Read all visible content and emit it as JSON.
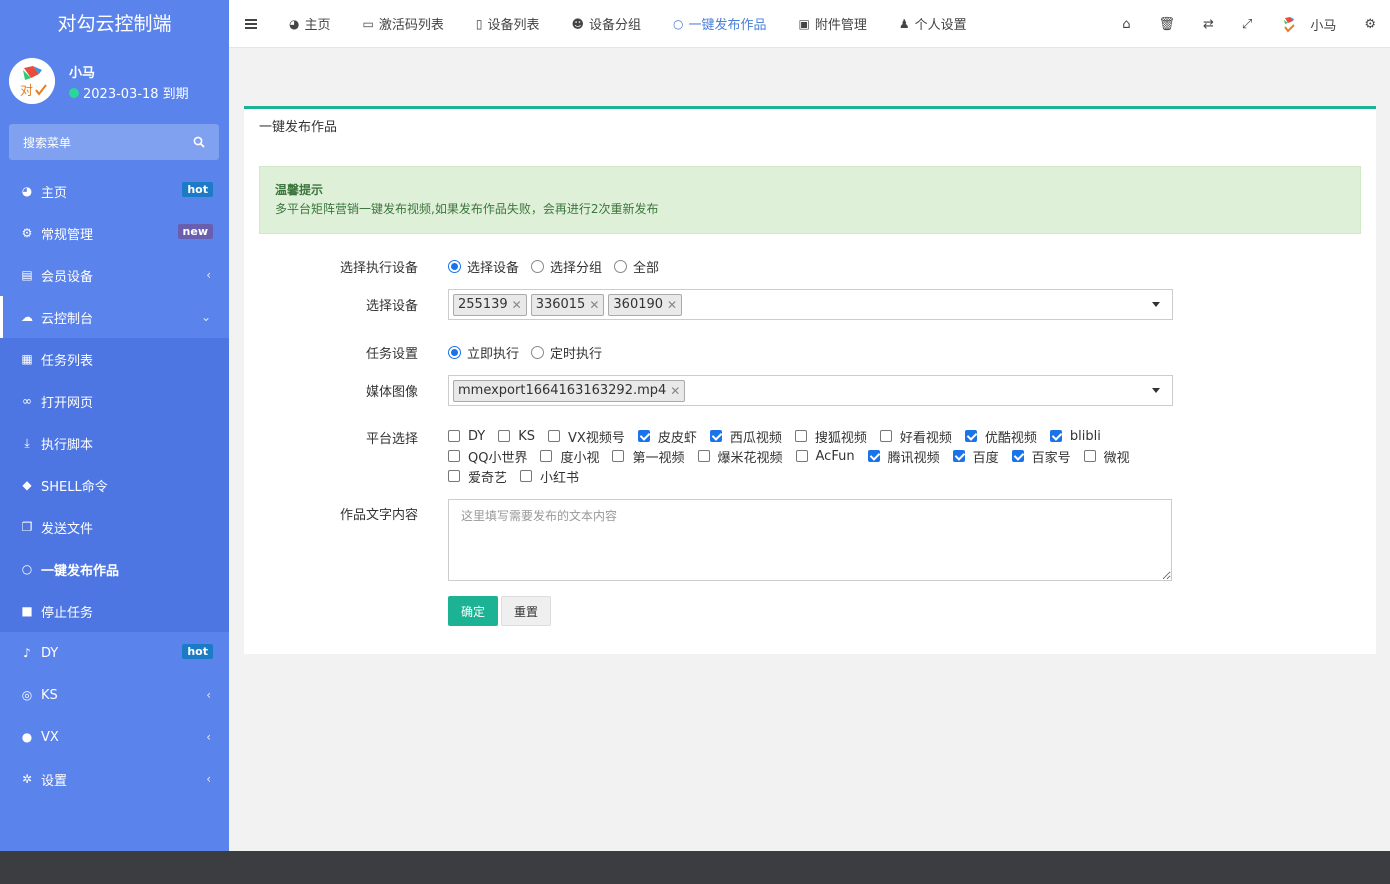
{
  "sidebar": {
    "title": "对勾云控制端",
    "avatar_text": "对",
    "user_name": "小马",
    "expiry": "2023-03-18 到期",
    "search_label": "搜索菜单",
    "items": [
      {
        "label": "主页",
        "icon": "dashboard-icon",
        "badge": "hot"
      },
      {
        "label": "常规管理",
        "icon": "cogs-icon",
        "badge": "new"
      },
      {
        "label": "会员设备",
        "icon": "id-card-icon"
      },
      {
        "label": "云控制台",
        "icon": "cloud-icon"
      },
      {
        "label": "任务列表",
        "icon": "grid-icon"
      },
      {
        "label": "打开网页",
        "icon": "link-icon"
      },
      {
        "label": "执行脚本",
        "icon": "download-icon"
      },
      {
        "label": "SHELL命令",
        "icon": "android-icon"
      },
      {
        "label": "发送文件",
        "icon": "copy-icon"
      },
      {
        "label": "一键发布作品",
        "icon": "circle-icon"
      },
      {
        "label": "停止任务",
        "icon": "stop-icon"
      },
      {
        "label": "DY",
        "icon": "tiktok-icon",
        "badge": "hot"
      },
      {
        "label": "KS",
        "icon": "eye-icon"
      },
      {
        "label": "VX",
        "icon": "wechat-icon"
      },
      {
        "label": "设置",
        "icon": "gear-icon"
      }
    ]
  },
  "topbar": {
    "tabs": [
      {
        "label": "主页",
        "icon": "dashboard-icon"
      },
      {
        "label": "激活码列表",
        "icon": "card-icon"
      },
      {
        "label": "设备列表",
        "icon": "mobile-icon"
      },
      {
        "label": "设备分组",
        "icon": "users-icon"
      },
      {
        "label": "一键发布作品",
        "icon": "circle-icon"
      },
      {
        "label": "附件管理",
        "icon": "image-icon"
      },
      {
        "label": "个人设置",
        "icon": "user-icon"
      }
    ],
    "user_name": "小马"
  },
  "panel": {
    "title": "一键发布作品",
    "alert_title": "温馨提示",
    "alert_message": "多平台矩阵营销一键发布视频,如果发布作品失败，会再进行2次重新发布",
    "device_scope_label": "选择执行设备",
    "device_scope_options": [
      "选择设备",
      "选择分组",
      "全部"
    ],
    "device_scope_selected": "选择设备",
    "devices_label": "选择设备",
    "devices": [
      "255139",
      "336015",
      "360190"
    ],
    "task_label": "任务设置",
    "task_options": [
      "立即执行",
      "定时执行"
    ],
    "task_selected": "立即执行",
    "media_label": "媒体图像",
    "media_files": [
      "mmexport1664163163292.mp4"
    ],
    "platform_label": "平台选择",
    "platforms": [
      {
        "name": "DY",
        "checked": false
      },
      {
        "name": "KS",
        "checked": false
      },
      {
        "name": "VX视频号",
        "checked": false
      },
      {
        "name": "皮皮虾",
        "checked": true
      },
      {
        "name": "西瓜视频",
        "checked": true
      },
      {
        "name": "搜狐视频",
        "checked": false
      },
      {
        "name": "好看视频",
        "checked": false
      },
      {
        "name": "优酷视频",
        "checked": true
      },
      {
        "name": "blibli",
        "checked": true
      },
      {
        "name": "QQ小世界",
        "checked": false
      },
      {
        "name": "度小视",
        "checked": false
      },
      {
        "name": "第一视频",
        "checked": false
      },
      {
        "name": "爆米花视频",
        "checked": false
      },
      {
        "name": "AcFun",
        "checked": false
      },
      {
        "name": "腾讯视频",
        "checked": true
      },
      {
        "name": "百度",
        "checked": true
      },
      {
        "name": "百家号",
        "checked": true
      },
      {
        "name": "微视",
        "checked": false
      },
      {
        "name": "爱奇艺",
        "checked": false
      },
      {
        "name": "小红书",
        "checked": false
      }
    ],
    "content_label": "作品文字内容",
    "content_placeholder": "这里填写需要发布的文本内容",
    "content_value": "",
    "confirm_label": "确定",
    "reset_label": "重置"
  },
  "colors": {
    "sidebar_bg": "#5b83ec",
    "accent_green": "#1cb394",
    "checkbox_blue": "#1a73e8",
    "badge_hot": "#1c7bc7",
    "badge_new": "#6a5fae"
  }
}
